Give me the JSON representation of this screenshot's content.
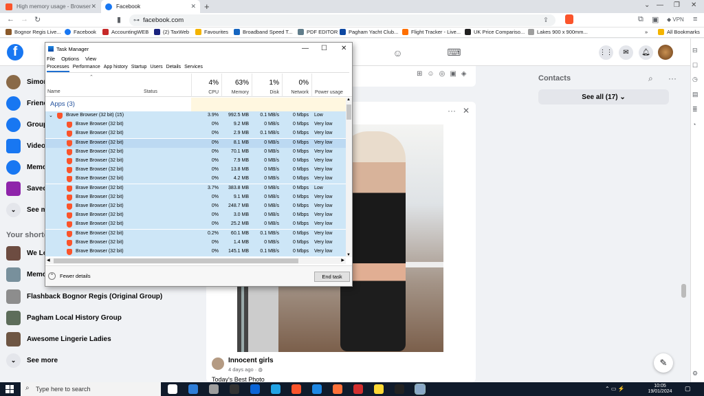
{
  "browser": {
    "tabs": [
      {
        "title": "High memory usage - Browser Suppo",
        "favicon_color": "#fb542b"
      },
      {
        "title": "Facebook",
        "favicon_color": "#1877f2"
      }
    ],
    "new_tab_symbol": "+",
    "url": "facebook.com",
    "vpn_label": "VPN",
    "bookmarks": [
      {
        "label": "Bognor Regis Live...",
        "color": "#8b5a2b"
      },
      {
        "label": "Facebook",
        "color": "#1877f2"
      },
      {
        "label": "AccountingWEB",
        "color": "#c62828"
      },
      {
        "label": "(2) TaxWeb",
        "color": "#1a237e"
      },
      {
        "label": "Favourites",
        "color": "#f4b400"
      },
      {
        "label": "Broadband Speed T...",
        "color": "#1565c0"
      },
      {
        "label": "PDF EDITOR",
        "color": "#607d8b"
      },
      {
        "label": "Pagham Yacht Club...",
        "color": "#0d47a1"
      },
      {
        "label": "Flight Tracker - Live...",
        "color": "#ff6f00"
      },
      {
        "label": "UK Price Compariso...",
        "color": "#212121"
      },
      {
        "label": "Lakes 900 x 900mm...",
        "color": "#9e9e9e"
      }
    ],
    "more_bookmarks": "»",
    "all_bookmarks": "All Bookmarks"
  },
  "facebook": {
    "left_nav": [
      {
        "label": "Simon",
        "icon": "profile-avatar",
        "color": "#8a6a48"
      },
      {
        "label": "Friends",
        "icon": "friends-icon",
        "color": "#1877f2"
      },
      {
        "label": "Groups",
        "icon": "groups-icon",
        "color": "#1877f2"
      },
      {
        "label": "Video",
        "icon": "video-icon",
        "color": "#1877f2"
      },
      {
        "label": "Memories",
        "icon": "memories-icon",
        "color": "#1877f2"
      },
      {
        "label": "Saved",
        "icon": "saved-icon",
        "color": "#8e24aa"
      },
      {
        "label": "See more",
        "icon": "chevron-down-icon",
        "color": "#e4e6eb"
      }
    ],
    "shortcuts_heading": "Your shortcuts",
    "shortcuts": [
      {
        "label": "We Lo",
        "color": "#6d4c41"
      },
      {
        "label": "Memo",
        "color": "#78909c"
      },
      {
        "label": "Flashback Bognor Regis (Original Group)",
        "color": "#8d8d8d"
      },
      {
        "label": "Pagham Local History Group",
        "color": "#5d6d5a"
      },
      {
        "label": "Awesome Lingerie Ladies",
        "color": "#6e5644"
      },
      {
        "label": "See more",
        "color": "#e4e6eb"
      }
    ],
    "contacts_heading": "Contacts",
    "see_all": "See all (17)",
    "post": {
      "author": "Innocent girls",
      "time": "4 days ago · ",
      "caption": "Today's Best Photo"
    }
  },
  "task_manager": {
    "title": "Task Manager",
    "menu": [
      "File",
      "Options",
      "View"
    ],
    "tabs": [
      "Processes",
      "Performance",
      "App history",
      "Startup",
      "Users",
      "Details",
      "Services"
    ],
    "columns": {
      "name": "Name",
      "status": "Status",
      "cpu": {
        "pct": "4%",
        "label": "CPU"
      },
      "memory": {
        "pct": "63%",
        "label": "Memory"
      },
      "disk": {
        "pct": "1%",
        "label": "Disk"
      },
      "network": {
        "pct": "0%",
        "label": "Network"
      },
      "power": {
        "label": "Power usage"
      }
    },
    "group_label": "Apps (3)",
    "rows": [
      {
        "name": "Brave Browser (32 bit) (15)",
        "cpu": "3.9%",
        "mem": "992.5 MB",
        "disk": "0.1 MB/s",
        "net": "0 Mbps",
        "power": "Low",
        "parent": true
      },
      {
        "name": "Brave Browser (32 bit)",
        "cpu": "0%",
        "mem": "9.2 MB",
        "disk": "0 MB/s",
        "net": "0 Mbps",
        "power": "Very low"
      },
      {
        "name": "Brave Browser (32 bit)",
        "cpu": "0%",
        "mem": "2.9 MB",
        "disk": "0.1 MB/s",
        "net": "0 Mbps",
        "power": "Very low"
      },
      {
        "name": "Brave Browser (32 bit)",
        "cpu": "0%",
        "mem": "8.1 MB",
        "disk": "0 MB/s",
        "net": "0 Mbps",
        "power": "Very low",
        "selected": true
      },
      {
        "name": "Brave Browser (32 bit)",
        "cpu": "0%",
        "mem": "70.1 MB",
        "disk": "0 MB/s",
        "net": "0 Mbps",
        "power": "Very low"
      },
      {
        "name": "Brave Browser (32 bit)",
        "cpu": "0%",
        "mem": "7.9 MB",
        "disk": "0 MB/s",
        "net": "0 Mbps",
        "power": "Very low"
      },
      {
        "name": "Brave Browser (32 bit)",
        "cpu": "0%",
        "mem": "13.8 MB",
        "disk": "0 MB/s",
        "net": "0 Mbps",
        "power": "Very low"
      },
      {
        "name": "Brave Browser (32 bit)",
        "cpu": "0%",
        "mem": "4.2 MB",
        "disk": "0 MB/s",
        "net": "0 Mbps",
        "power": "Very low"
      },
      {
        "name": "Brave Browser (32 bit)",
        "cpu": "3.7%",
        "mem": "383.8 MB",
        "disk": "0 MB/s",
        "net": "0 Mbps",
        "power": "Low"
      },
      {
        "name": "Brave Browser (32 bit)",
        "cpu": "0%",
        "mem": "9.1 MB",
        "disk": "0 MB/s",
        "net": "0 Mbps",
        "power": "Very low"
      },
      {
        "name": "Brave Browser (32 bit)",
        "cpu": "0%",
        "mem": "248.7 MB",
        "disk": "0 MB/s",
        "net": "0 Mbps",
        "power": "Very low"
      },
      {
        "name": "Brave Browser (32 bit)",
        "cpu": "0%",
        "mem": "3.0 MB",
        "disk": "0 MB/s",
        "net": "0 Mbps",
        "power": "Very low"
      },
      {
        "name": "Brave Browser (32 bit)",
        "cpu": "0%",
        "mem": "25.2 MB",
        "disk": "0 MB/s",
        "net": "0 Mbps",
        "power": "Very low"
      },
      {
        "name": "Brave Browser (32 bit)",
        "cpu": "0.2%",
        "mem": "60.1 MB",
        "disk": "0.1 MB/s",
        "net": "0 Mbps",
        "power": "Very low"
      },
      {
        "name": "Brave Browser (32 bit)",
        "cpu": "0%",
        "mem": "1.4 MB",
        "disk": "0 MB/s",
        "net": "0 Mbps",
        "power": "Very low"
      },
      {
        "name": "Brave Browser (32 bit)",
        "cpu": "0%",
        "mem": "145.1 MB",
        "disk": "0.1 MB/s",
        "net": "0 Mbps",
        "power": "Very low"
      }
    ],
    "fewer_details": "Fewer details",
    "end_task": "End task"
  },
  "taskbar": {
    "search_placeholder": "Type here to search",
    "time": "10:05",
    "date": "19/01/2024",
    "apps": [
      {
        "name": "task-view",
        "color": "#ffffff"
      },
      {
        "name": "mail",
        "color": "#2f7ed8"
      },
      {
        "name": "settings",
        "color": "#9e9e9e"
      },
      {
        "name": "terminal",
        "color": "#333333"
      },
      {
        "name": "outlook",
        "color": "#0a64d6"
      },
      {
        "name": "code",
        "color": "#22a3e5"
      },
      {
        "name": "brave",
        "color": "#fb542b"
      },
      {
        "name": "photos",
        "color": "#1e88e5"
      },
      {
        "name": "firefox",
        "color": "#ff7139"
      },
      {
        "name": "acrobat",
        "color": "#d32f2f"
      },
      {
        "name": "smiley",
        "color": "#fdd835"
      },
      {
        "name": "word",
        "color": "#222222"
      },
      {
        "name": "task-manager",
        "color": "#8aa8c8"
      }
    ]
  }
}
